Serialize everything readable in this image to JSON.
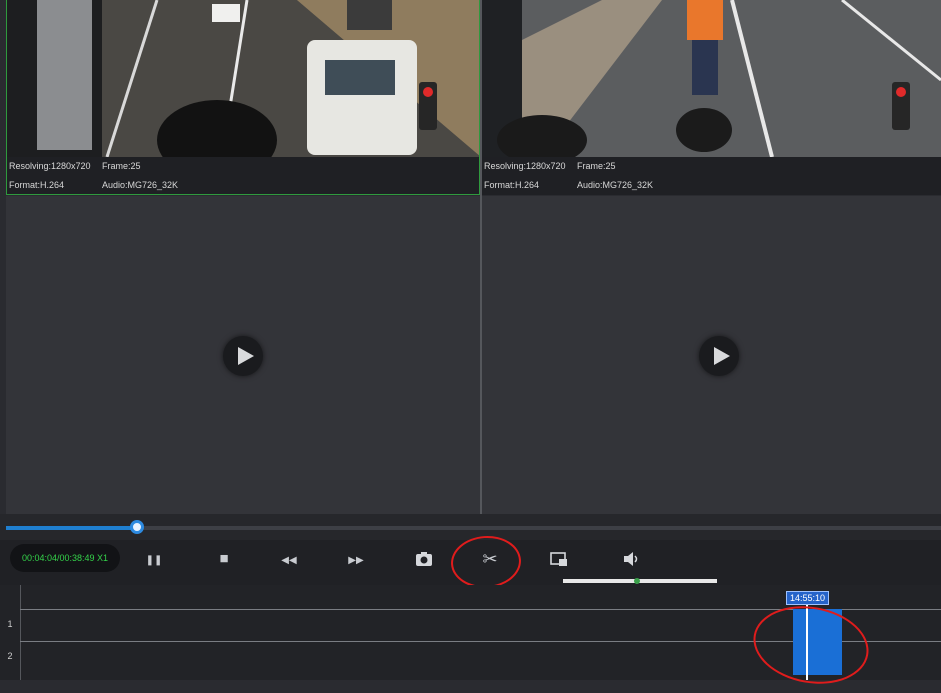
{
  "channels": [
    {
      "id": "ch1",
      "resolution_label": "Resolving:1280x720",
      "frame_label": "Frame:25",
      "format_label": "Format:H.264",
      "audio_label": "Audio:MG726_32K"
    },
    {
      "id": "ch2",
      "resolution_label": "Resolving:1280x720",
      "frame_label": "Frame:25",
      "format_label": "Format:H.264",
      "audio_label": "Audio:MG726_32K"
    }
  ],
  "empty_channels": [
    {
      "id": "ch3",
      "icon": "play-icon"
    },
    {
      "id": "ch4",
      "icon": "play-icon"
    }
  ],
  "playback": {
    "timecode": "00:04:04/00:38:49 X1",
    "progress_fraction": 0.14
  },
  "controls": [
    {
      "name": "pause-button",
      "icon": "pause-icon",
      "glyph": "❚❚"
    },
    {
      "name": "stop-button",
      "icon": "stop-icon",
      "glyph": "■"
    },
    {
      "name": "rewind-button",
      "icon": "rewind-icon",
      "glyph": "◀◀"
    },
    {
      "name": "fast-forward-button",
      "icon": "fast-forward-icon",
      "glyph": "▶▶"
    },
    {
      "name": "snapshot-button",
      "icon": "camera-icon",
      "glyph": "📷"
    },
    {
      "name": "clip-button",
      "icon": "scissors-icon",
      "glyph": "✂"
    },
    {
      "name": "window-mode-button",
      "icon": "window-icon",
      "glyph": "▭"
    },
    {
      "name": "volume-button",
      "icon": "volume-icon",
      "glyph": "🔊"
    }
  ],
  "timeline": {
    "rows": [
      "1",
      "2"
    ],
    "cursor_label": "14:55:10",
    "clip_color": "#1a6fd6"
  },
  "colors": {
    "accent": "#2d8ae0",
    "timecode": "#34d24a",
    "annotation": "#e01c1c",
    "selected_border": "#2f9a3e"
  }
}
